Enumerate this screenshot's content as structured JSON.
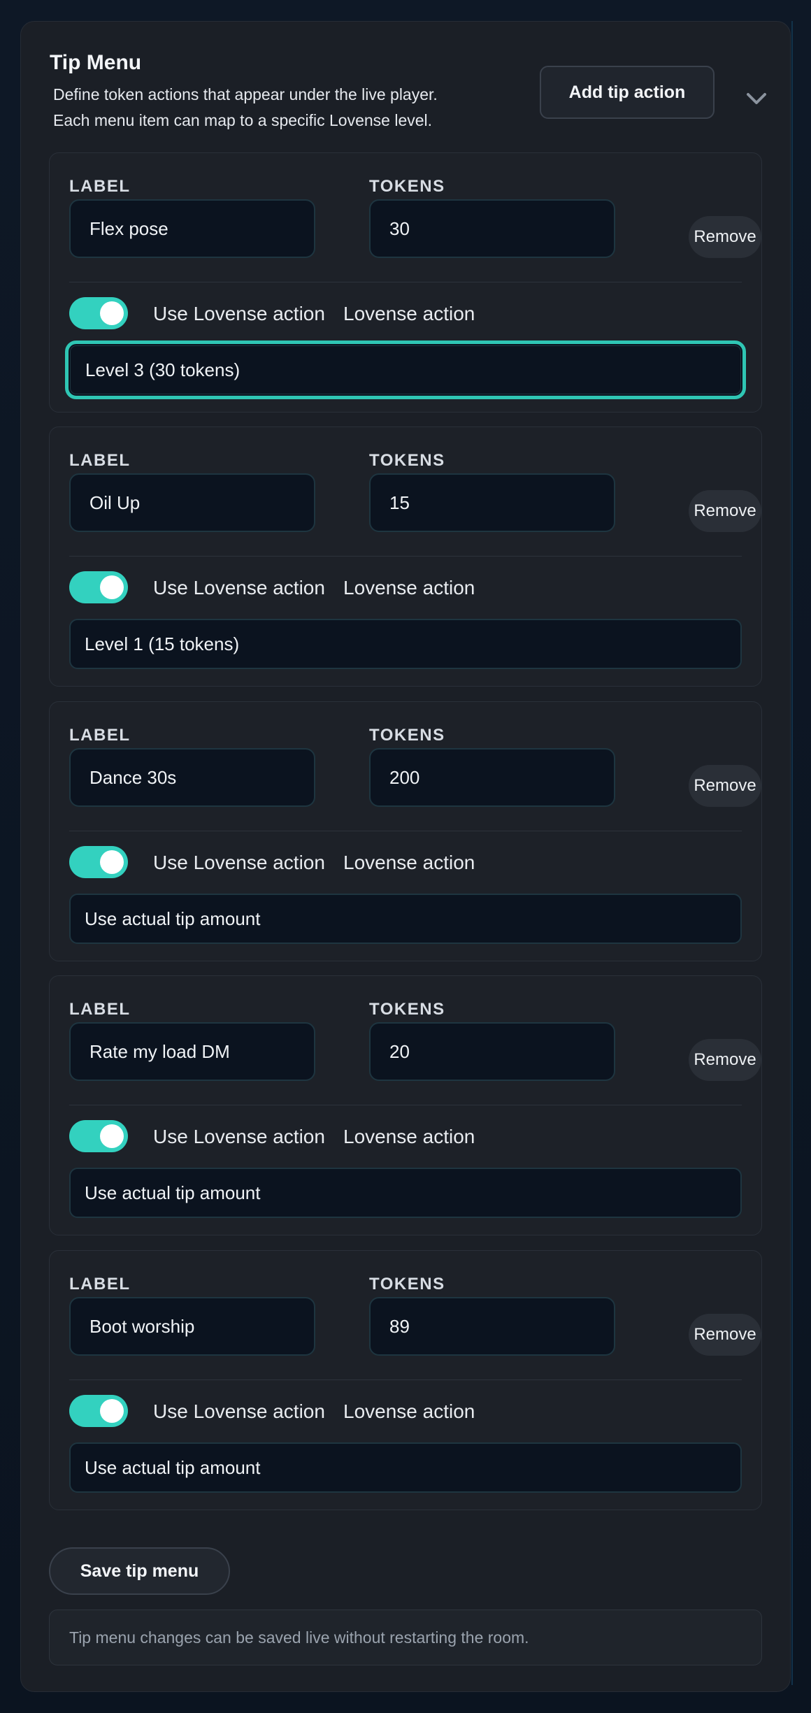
{
  "panel": {
    "title": "Tip Menu",
    "description_line1": "Define token actions that appear under the live player.",
    "description_line2": "Each menu item can map to a specific Lovense level.",
    "add_button": "Add tip action",
    "collapse_icon": "chevron-down-icon"
  },
  "field_labels": {
    "label": "LABEL",
    "tokens": "TOKENS",
    "remove": "Remove",
    "use_lovense": "Use Lovense action",
    "lovense_action": "Lovense action"
  },
  "items": [
    {
      "label": "Flex pose",
      "tokens": "30",
      "lovense_enabled": true,
      "lovense_action": "Level 3 (30 tokens)"
    },
    {
      "label": "Oil Up",
      "tokens": "15",
      "lovense_enabled": true,
      "lovense_action": "Level 1 (15 tokens)"
    },
    {
      "label": "Dance 30s",
      "tokens": "200",
      "lovense_enabled": true,
      "lovense_action": "Use actual tip amount"
    },
    {
      "label": "Rate my load DM",
      "tokens": "20",
      "lovense_enabled": true,
      "lovense_action": "Use actual tip amount"
    },
    {
      "label": "Boot worship",
      "tokens": "89",
      "lovense_enabled": true,
      "lovense_action": "Use actual tip amount"
    }
  ],
  "footer": {
    "save_button": "Save tip menu",
    "note": "Tip menu changes can be saved live without restarting the room."
  },
  "colors": {
    "accent": "#33d1bf",
    "panel_bg": "#1b1f26",
    "input_bg": "#0b131f",
    "page_bg": "#0c1522"
  }
}
